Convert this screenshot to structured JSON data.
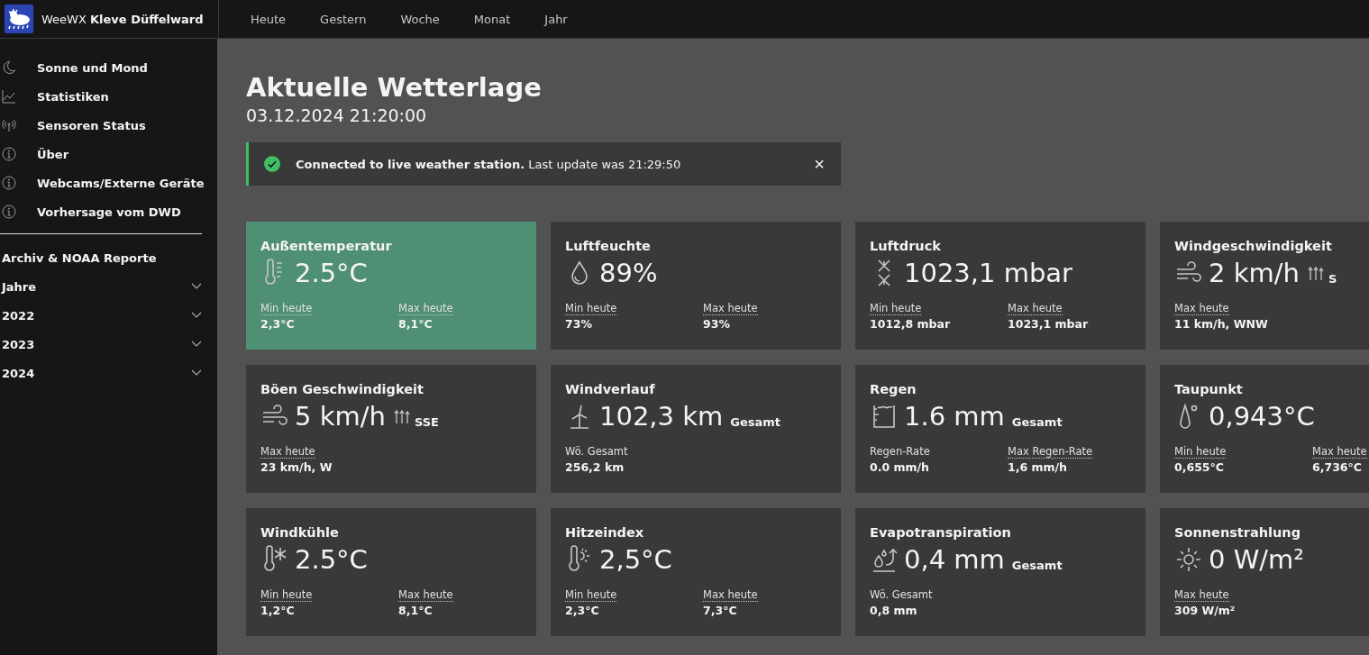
{
  "header": {
    "brand": "WeeWX **Kleve Düffelward**",
    "nav": [
      {
        "label": "Heute"
      },
      {
        "label": "Gestern"
      },
      {
        "label": "Woche"
      },
      {
        "label": "Monat"
      },
      {
        "label": "Jahr"
      }
    ]
  },
  "sidebar": {
    "links": [
      {
        "label": "Sonne und Mond",
        "kind": "moon"
      },
      {
        "label": "Statistiken",
        "kind": "chart"
      },
      {
        "label": "Sensoren Status",
        "kind": "antenna"
      },
      {
        "label": "Über",
        "kind": "info"
      },
      {
        "label": "Webcams/Externe Geräte",
        "kind": "info"
      },
      {
        "label": "Vorhersage vom DWD",
        "kind": "info"
      }
    ],
    "archive_heading": "Archiv & NOAA Reporte",
    "archive": [
      {
        "label": "Jahre",
        "expanded": false
      },
      {
        "label": "2022",
        "expanded": false
      },
      {
        "label": "2023",
        "expanded": false
      },
      {
        "label": "2024",
        "expanded": false
      }
    ]
  },
  "page": {
    "title": "Aktuelle Wetterlage",
    "datetime": "03.12.2024 21:20:00"
  },
  "alert": {
    "message": "**Connected to live weather station.** Last update was 21:29:50",
    "close": "×"
  },
  "cards": [
    {
      "title": "Außentemperatur",
      "kind": "temperature",
      "highlighted": true,
      "value": "2.5°C",
      "stats": [
        {
          "label": "Min heute",
          "value": "2,3°C",
          "dotted": true
        },
        {
          "label": "Max heute",
          "value": "8,1°C",
          "dotted": true
        }
      ]
    },
    {
      "title": "Luftfeuchte",
      "kind": "humidity",
      "highlighted": false,
      "value": "89%",
      "stats": [
        {
          "label": "Min heute",
          "value": "73%",
          "dotted": true
        },
        {
          "label": "Max heute",
          "value": "93%",
          "dotted": true
        }
      ]
    },
    {
      "title": "Luftdruck",
      "kind": "pressure",
      "highlighted": false,
      "value": "1023,1 mbar",
      "stats": [
        {
          "label": "Min heute",
          "value": "1012,8 mbar",
          "dotted": true
        },
        {
          "label": "Max heute",
          "value": "1023,1 mbar",
          "dotted": true
        }
      ]
    },
    {
      "title": "Windgeschwindigkeit",
      "kind": "wind",
      "highlighted": false,
      "value": "2 km/h",
      "direction": "S",
      "stats": [
        {
          "label": "Max heute",
          "value": "11 km/h, WNW",
          "dotted": true
        }
      ]
    },
    {
      "title": "Böen Geschwindigkeit",
      "kind": "wind",
      "highlighted": false,
      "value": "5 km/h",
      "direction": "SSE",
      "stats": [
        {
          "label": "Max heute",
          "value": "23 km/h, W",
          "dotted": true
        }
      ]
    },
    {
      "title": "Windverlauf",
      "kind": "windmill",
      "highlighted": false,
      "value": "102,3 km",
      "suffix": "Gesamt",
      "stats": [
        {
          "label": "Wö. Gesamt",
          "value": "256,2 km",
          "dotted": false
        }
      ]
    },
    {
      "title": "Regen",
      "kind": "rain",
      "highlighted": false,
      "value": "1.6 mm",
      "suffix": "Gesamt",
      "stats": [
        {
          "label": "Regen-Rate",
          "value": "0.0 mm/h",
          "dotted": false
        },
        {
          "label": "Max Regen-Rate",
          "value": "1,6 mm/h",
          "dotted": true
        }
      ]
    },
    {
      "title": "Taupunkt",
      "kind": "dewpoint",
      "highlighted": false,
      "value": "0,943°C",
      "stats": [
        {
          "label": "Min heute",
          "value": "0,655°C",
          "dotted": true
        },
        {
          "label": "Max heute",
          "value": "6,736°C",
          "dotted": true
        }
      ]
    },
    {
      "title": "Windkühle",
      "kind": "windchill",
      "highlighted": false,
      "value": "2.5°C",
      "stats": [
        {
          "label": "Min heute",
          "value": "1,2°C",
          "dotted": true
        },
        {
          "label": "Max heute",
          "value": "8,1°C",
          "dotted": true
        }
      ]
    },
    {
      "title": "Hitzeindex",
      "kind": "heat",
      "highlighted": false,
      "value": "2,5°C",
      "stats": [
        {
          "label": "Min heute",
          "value": "2,3°C",
          "dotted": true
        },
        {
          "label": "Max heute",
          "value": "7,3°C",
          "dotted": true
        }
      ]
    },
    {
      "title": "Evapotranspiration",
      "kind": "evaporation",
      "highlighted": false,
      "value": "0,4 mm",
      "suffix": "Gesamt",
      "stats": [
        {
          "label": "Wö. Gesamt",
          "value": "0,8 mm",
          "dotted": false
        }
      ]
    },
    {
      "title": "Sonnenstrahlung",
      "kind": "sun",
      "highlighted": false,
      "value": "0 W/m²",
      "stats": [
        {
          "label": "Max heute",
          "value": "309 W/m²",
          "dotted": true
        }
      ]
    }
  ]
}
